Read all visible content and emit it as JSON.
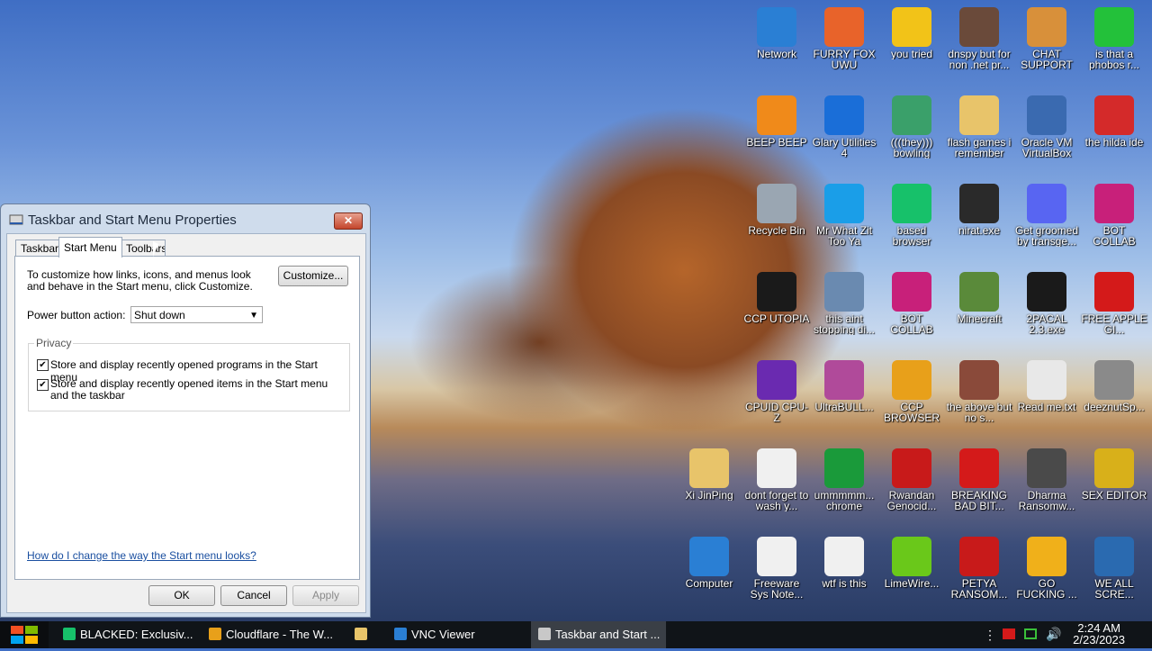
{
  "desktop_icons": [
    {
      "label": "Network",
      "icon": "network-icon",
      "color": "#2a7fd4",
      "col": 0,
      "row": 0
    },
    {
      "label": "FURRY FOX UWU",
      "icon": "firefox-icon",
      "color": "#e8632a",
      "col": 1,
      "row": 0
    },
    {
      "label": "you tried",
      "icon": "star-icon",
      "color": "#f2c318",
      "col": 2,
      "row": 0
    },
    {
      "label": "dnspy but for non .net pr...",
      "icon": "portrait-icon",
      "color": "#6a4a3a",
      "col": 3,
      "row": 0
    },
    {
      "label": "CHAT SUPPORT",
      "icon": "person-icon",
      "color": "#d8903a",
      "col": 4,
      "row": 0
    },
    {
      "label": "is that a phobos r...",
      "icon": "dots-icon",
      "color": "#23c13a",
      "col": 5,
      "row": 0
    },
    {
      "label": "BEEP BEEP",
      "icon": "vlc-icon",
      "color": "#f08a1a",
      "col": 0,
      "row": 1
    },
    {
      "label": "Glary Utilities 4",
      "icon": "moon-icon",
      "color": "#1a6ed8",
      "col": 1,
      "row": 1
    },
    {
      "label": "(((they))) bowling",
      "icon": "elf-icon",
      "color": "#3aa06a",
      "col": 2,
      "row": 1
    },
    {
      "label": "flash games i remember",
      "icon": "folder-icon",
      "color": "#e8c46a",
      "col": 3,
      "row": 1
    },
    {
      "label": "Oracle VM VirtualBox",
      "icon": "virtualbox-icon",
      "color": "#3a6ab0",
      "col": 4,
      "row": 1
    },
    {
      "label": "the hilda ide",
      "icon": "devcpp-icon",
      "color": "#d42a2a",
      "col": 5,
      "row": 1
    },
    {
      "label": "Recycle Bin",
      "icon": "recycle-bin-icon",
      "color": "#9aa6b2",
      "col": 0,
      "row": 2
    },
    {
      "label": "Mr What Zit Too Ya",
      "icon": "skype-icon",
      "color": "#1a9ee8",
      "col": 1,
      "row": 2
    },
    {
      "label": "based browser",
      "icon": "document-green-icon",
      "color": "#17c16a",
      "col": 2,
      "row": 2
    },
    {
      "label": "nirat.exe",
      "icon": "skull-icon",
      "color": "#2a2a2a",
      "col": 3,
      "row": 2
    },
    {
      "label": "Get groomed by transge...",
      "icon": "discord-icon",
      "color": "#5865f2",
      "col": 4,
      "row": 2
    },
    {
      "label": "BOT COLLAB",
      "icon": "monitor-pink-icon",
      "color": "#c8207a",
      "col": 5,
      "row": 2
    },
    {
      "label": "CCP UTOPIA",
      "icon": "red-circle-icon",
      "color": "#1a1a1a",
      "col": 0,
      "row": 3
    },
    {
      "label": "this aint stopping di...",
      "icon": "computer-search-icon",
      "color": "#6a8ab0",
      "col": 1,
      "row": 3
    },
    {
      "label": "BOT COLLAB",
      "icon": "monitor-pink-icon",
      "color": "#c8207a",
      "col": 2,
      "row": 3
    },
    {
      "label": "Minecraft",
      "icon": "minecraft-icon",
      "color": "#5a8a3a",
      "col": 3,
      "row": 3
    },
    {
      "label": "2PACAL 2.3.exe",
      "icon": "console-icon",
      "color": "#1a1a1a",
      "col": 4,
      "row": 3
    },
    {
      "label": "FREE APPLE GI...",
      "icon": "apple-icon",
      "color": "#d41a1a",
      "col": 5,
      "row": 3
    },
    {
      "label": "CPUID CPU-Z",
      "icon": "cpuz-icon",
      "color": "#6a2ab0",
      "col": 0,
      "row": 4
    },
    {
      "label": "UltraBULL...",
      "icon": "disc-icon",
      "color": "#b04a9a",
      "col": 1,
      "row": 4
    },
    {
      "label": "CCP BROWSER",
      "icon": "colorwheel-icon",
      "color": "#e8a01a",
      "col": 2,
      "row": 4
    },
    {
      "label": "the above but no s...",
      "icon": "portrait-64-icon",
      "color": "#8a4a3a",
      "col": 3,
      "row": 4
    },
    {
      "label": "Read me.txt",
      "icon": "text-file-icon",
      "color": "#e8e8e8",
      "col": 4,
      "row": 4
    },
    {
      "label": "deeznutSp...",
      "icon": "stack-icon",
      "color": "#8a8a8a",
      "col": 5,
      "row": 4
    },
    {
      "label": "Xi JinPing",
      "icon": "folder-person-icon",
      "color": "#e8c46a",
      "col": -1,
      "row": 5
    },
    {
      "label": "dont forget to wash y...",
      "icon": "calendar-file-icon",
      "color": "#f0f0f0",
      "col": 0,
      "row": 5
    },
    {
      "label": "ummmmm... chrome",
      "icon": "chrome-icon",
      "color": "#1a9a3a",
      "col": 1,
      "row": 5
    },
    {
      "label": "Rwandan Genocid...",
      "icon": "meme-icon",
      "color": "#c81a1a",
      "col": 2,
      "row": 5
    },
    {
      "label": "BREAKING BAD BIT...",
      "icon": "angry-bird-icon",
      "color": "#d41a1a",
      "col": 3,
      "row": 5
    },
    {
      "label": "Dharma Ransomw...",
      "icon": "skull-metal-icon",
      "color": "#4a4a4a",
      "col": 4,
      "row": 5
    },
    {
      "label": "SEX EDITOR",
      "icon": "hxd-icon",
      "color": "#d8b01a",
      "col": 5,
      "row": 5
    },
    {
      "label": "Computer",
      "icon": "computer-icon",
      "color": "#2a7fd4",
      "col": -1,
      "row": 6
    },
    {
      "label": "Freeware Sys Note...",
      "icon": "blank-file-icon",
      "color": "#f0f0f0",
      "col": 0,
      "row": 6
    },
    {
      "label": "wtf is this",
      "icon": "calendar-file-icon",
      "color": "#f0f0f0",
      "col": 1,
      "row": 6
    },
    {
      "label": "LimeWire...",
      "icon": "limewire-icon",
      "color": "#6ac81a",
      "col": 2,
      "row": 6
    },
    {
      "label": "PETYA RANSOM...",
      "icon": "skull-red-icon",
      "color": "#c81a1a",
      "col": 3,
      "row": 6
    },
    {
      "label": "GO FUCKING ...",
      "icon": "de-icon",
      "color": "#f0b01a",
      "col": 4,
      "row": 6
    },
    {
      "label": "WE ALL SCRE...",
      "icon": "computer-blue-icon",
      "color": "#2a6ab0",
      "col": 5,
      "row": 6
    }
  ],
  "dialog": {
    "title": "Taskbar and Start Menu Properties",
    "close_label": "✕",
    "tabs": [
      "Taskbar",
      "Start Menu",
      "Toolbars"
    ],
    "description": "To customize how links, icons, and menus look and behave in the Start menu, click Customize.",
    "customize_label": "Customize...",
    "power_label": "Power button action:",
    "power_value": "Shut down",
    "privacy_label": "Privacy",
    "check1": "Store and display recently opened programs in the Start menu",
    "check2": "Store and display recently opened items in the Start menu and the taskbar",
    "check_mark": "✔",
    "help_link": "How do I change the way the Start menu looks?",
    "ok_label": "OK",
    "cancel_label": "Cancel",
    "apply_label": "Apply"
  },
  "taskbar": {
    "items": [
      {
        "label": "BLACKED: Exclusiv...",
        "icon": "document-green-icon",
        "color": "#17c16a"
      },
      {
        "label": "Cloudflare - The W...",
        "icon": "chrome-icon",
        "color": "#e8a01a"
      },
      {
        "label": "",
        "icon": "folder-icon",
        "color": "#e8c46a"
      },
      {
        "label": "VNC Viewer",
        "icon": "vnc-icon",
        "color": "#2a7fd4"
      },
      {
        "label": "Taskbar and Start ...",
        "icon": "properties-icon",
        "color": "#c8c8c8"
      }
    ],
    "time": "2:24 AM",
    "date": "2/23/2023"
  }
}
